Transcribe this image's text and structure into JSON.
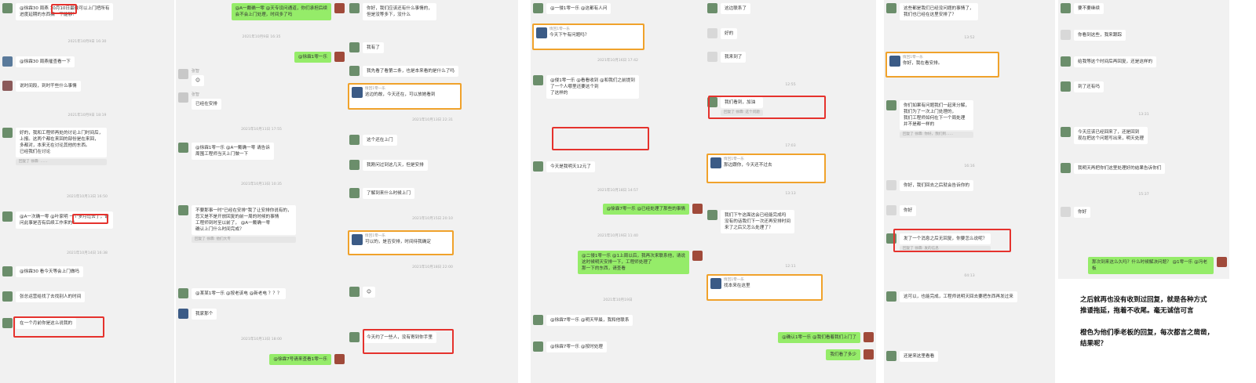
{
  "colors": {
    "red": "#e5322d",
    "orange": "#f0a22b",
    "green_bubble": "#95ec69",
    "panel_bg": "#f1f1f1"
  },
  "p1": {
    "messages": [
      {
        "name": "",
        "text": "@徐霖30 周燕 10月10日最晚可以上门把所有\n进度延期的东西搞一下能够？"
      },
      {
        "name": "",
        "text": "@徐霖30 周燕催查看一下"
      },
      {
        "name": "",
        "text": "说时间段，到时干些什么事情"
      },
      {
        "name": "",
        "text": "好的，我和工程师再处的讨论上门时间后，\n上报。这两个都在来回的部份是在来回，\n多都对，本来无在讨论其他的东西。\n已经我们在讨论"
      },
      {
        "name": "",
        "text": "@A一次确一零 @叶家明 一个多月过去了，请\n问此事是否有后续工作来的？"
      },
      {
        "name": "",
        "text": "@徐霖30 看今天等会上门做吗"
      },
      {
        "name": "",
        "text": "张总运营给找了去找别人的时间"
      },
      {
        "name": "",
        "text": "在一个月前你是这么说我的"
      }
    ],
    "ts": [
      "2021年10月9日 16:30",
      "2021年10月9日 18:19",
      "2021年10月13日 16:50",
      "2021年10月14日 16:38",
      "2021年10月15日 10:05"
    ],
    "quotes": [
      "回复了 徐霖: ……"
    ]
  },
  "p2": {
    "messages": [
      {
        "name": "",
        "text": "@A一戴确一零 @天专设问通道，你们承担后续\n会不会上门处理，时间多了吗"
      },
      {
        "name": "",
        "text": "@徐霖1零一乐"
      },
      {
        "name": "张智",
        "text": "😊"
      },
      {
        "name": "张智",
        "text": "已经在安排"
      },
      {
        "name": "",
        "text": "@徐霖1零一乐 @A一戴确一零 请告诉\n周围工程师当天上门做一下"
      },
      {
        "name": "",
        "text": "不要那事一时\"已经在安排\"我了让安排你说有的，\n您又是不是开放回复的前一周的时候的事情\n工程师到时至以前了， @A一戴确一零\n确认上门什么时间完成？"
      },
      {
        "name": "",
        "text": "@某某1零一乐 @按老该电 @新老电 ？？？"
      },
      {
        "name": "",
        "text": "我家那个"
      },
      {
        "name": "",
        "text": "@徐霖7号请来查看1零一乐"
      }
    ],
    "ts": [
      "2021年10月9日 16:35",
      "2021年10月11日 17:55",
      "2021年10月13日 10:35",
      "2021年10月13日 18:00"
    ],
    "quotes": [
      "回复了 徐霖: 他们大专"
    ]
  },
  "p3": {
    "messages": [
      {
        "name": "",
        "text": "你好，我们应该还有什么事情的，\n但是没等多下，没什么"
      },
      {
        "name": "",
        "text": "我有了"
      },
      {
        "name": "",
        "text": "我先看了看第二条，也是本来看的是什么了吗"
      },
      {
        "name": "",
        "text": "这个还在上门"
      },
      {
        "name": "",
        "text": "我刚问过到这几天，但是安排"
      },
      {
        "name": "",
        "text": "了解到来什么时候上门"
      },
      {
        "name": "",
        "text": "😊"
      },
      {
        "name": "",
        "text": "今天约了一些人，没有寄到你手里"
      }
    ],
    "cards": [
      {
        "name": "情回1零一乐",
        "text": "这边的故，今天还在，可以放她看到"
      },
      {
        "name": "情回1零一乐",
        "text": "可以的，是否安排，时间待我确定"
      }
    ],
    "ts": [
      "2021年10月13日 22:31",
      "2021年10月15日 20:10",
      "2021年10月18日 22:00"
    ]
  },
  "p4": {
    "messages": [
      {
        "name": "",
        "text": "@一侵1零一乐 @这都有人问"
      },
      {
        "name": "",
        "text": "@侵1零一乐 @看看收到 @和我们之前提到\n了一个人哪里还要这个到\n了这样的"
      },
      {
        "name": "",
        "text": "今天是我明天12元了"
      },
      {
        "name": "",
        "text": "@徐霖7零一乐 @已经处理了那些的事情"
      },
      {
        "name": "",
        "text": "@二侵1零一乐 @1上周以后，我再次来联系他，请说\n这时候明天安排一下，工程师处理了\n那一下的东西，请查看"
      },
      {
        "name": "",
        "text": "@徐霖7零一乐 @明天早晨，我和他联系"
      },
      {
        "name": "",
        "text": "@徐霖7零一乐 @按时处理"
      }
    ],
    "cards": [
      {
        "name": "情回1零一乐",
        "text": "今天下午有问题吗？"
      }
    ],
    "ts": [
      "2021年10月16日 17:42",
      "2021年10月18日 14:57",
      "2021年10月19日 11:40",
      "2021年10月19日"
    ]
  },
  "p5": {
    "messages": [
      {
        "name": "",
        "text": "这边联系了"
      },
      {
        "name": "",
        "text": "好的"
      },
      {
        "name": "",
        "text": "我来到了"
      },
      {
        "name": "",
        "text": "我们看到，加油"
      },
      {
        "name": "",
        "text": "我们下午这面这会已经能完成吗\n没有的话我们下一次还再安排时间\n来了之后又怎么处理了？"
      },
      {
        "name": "",
        "text": "@确认1零一乐 @我们看着我们上门了"
      },
      {
        "name": "",
        "text": "我们看了多少"
      }
    ],
    "cards": [
      {
        "name": "情回1零一乐",
        "text": "那边跟你，今天还不过去"
      },
      {
        "name": "情回1零一乐",
        "text": "找本来在这里"
      }
    ],
    "ts": [
      "12:55",
      "17:03",
      "13:13",
      "12:11",
      "17:45"
    ],
    "quotes": [
      "回复了 徐霖: 这个问题"
    ]
  },
  "p6": {
    "messages": [
      {
        "name": "",
        "text": "这些都是我们已经没问题的事情了，\n我们也已经在这里安排了？"
      },
      {
        "name": "",
        "text": "你们如果有问题我们一起来分解，\n我们为了一次上门处理的，\n我们工程师如何在下一个周处理\n并不是都一样的"
      },
      {
        "name": "",
        "text": "你好，我们回去之后就会告诉你的"
      },
      {
        "name": "",
        "text": "你好"
      },
      {
        "name": "",
        "text": "发了一个消息之后无回复，你要怎么说呢？"
      },
      {
        "name": "",
        "text": "这可以，也能完成，工程师说明天回去要把东西再发过来"
      },
      {
        "name": "",
        "text": "还是来这里看看"
      }
    ],
    "cards": [
      {
        "name": "情回1零一乐",
        "text": "你好，我在看安排。"
      }
    ],
    "ts": [
      "13:52",
      "16:16",
      "04:13"
    ],
    "quotes": [
      "回复了 徐霖: 你好，我们到……",
      "回复了 徐霖: 发的信息"
    ]
  },
  "p7": {
    "messages": [
      {
        "name": "",
        "text": "要不要继续"
      },
      {
        "name": "",
        "text": "你看到这些，我来跟踪"
      },
      {
        "name": "",
        "text": "给我等这个时间后再回复，还是这样的"
      },
      {
        "name": "",
        "text": "到了还有吗"
      },
      {
        "name": "",
        "text": "今天应该已经回来了，还是回到\n现在把这个问题写出来，明天处理"
      },
      {
        "name": "",
        "text": "我明天再把你们这里处理好的结果告诉你们"
      },
      {
        "name": "",
        "text": "你好"
      },
      {
        "name": "",
        "text": "那次到来这么久吗？什么时候解决问题？ @1零一乐 @冯老板"
      }
    ],
    "ts": [
      "13:31",
      "15:37"
    ],
    "footer": "之后就再也没有收到过回复，就是各种方式\n推诿拖延，拖着不收尾。毫无诚信可言\n\n橙色为他们季老板的回复，每次都言之凿凿，\n结果呢？"
  }
}
